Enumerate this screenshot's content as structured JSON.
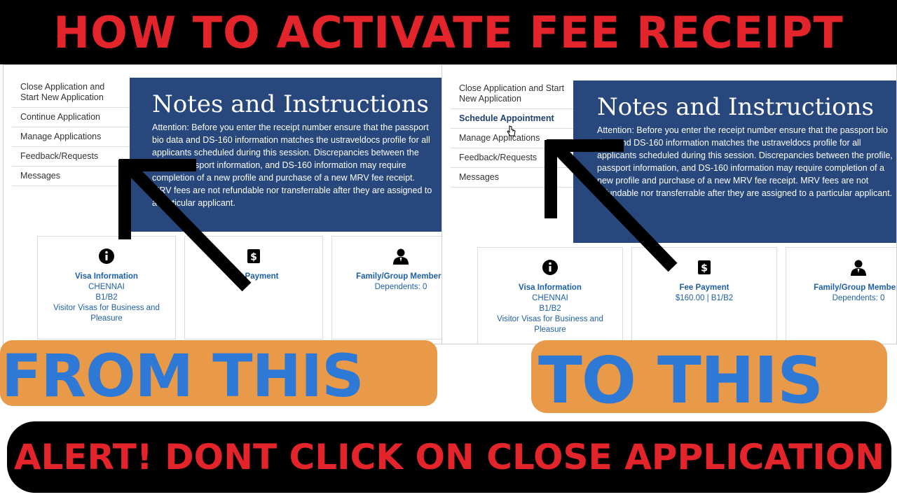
{
  "headline": "HOW TO ACTIVATE FEE RECEIPT",
  "before": {
    "menu": [
      "Close Application and Start New Application",
      "Continue Application",
      "Manage Applications",
      "Feedback/Requests",
      "Messages"
    ],
    "notes_title": "Notes and Instructions",
    "notes_text": "Attention: Before you enter the receipt number ensure that the passport bio data and DS-160 information matches the ustraveldocs profile for all applicants scheduled during this session. Discrepancies between the profile, passport information, and DS-160 information may require completion of a new profile and purchase of a new MRV fee receipt. MRV fees are not refundable nor transferrable after they are assigned to a particular applicant.",
    "cards": {
      "visa": {
        "title": "Visa Information",
        "line1": "CHENNAI",
        "line2": "B1/B2",
        "line3": "Visitor Visas for Business and Pleasure"
      },
      "fee": {
        "title": "Fee Payment"
      },
      "family": {
        "title": "Family/Group Members",
        "line1": "Dependents: 0"
      }
    }
  },
  "after": {
    "menu": [
      "Close Application and Start New Application",
      "Schedule Appointment",
      "Manage Applications",
      "Feedback/Requests",
      "Messages"
    ],
    "notes_title": "Notes and Instructions",
    "notes_text": "Attention: Before you enter the receipt number ensure that the passport bio data and DS-160 information matches the ustraveldocs profile for all applicants scheduled during this session. Discrepancies between the profile, passport information, and DS-160 information may require completion of a new profile and purchase of a new MRV fee receipt. MRV fees are not refundable nor transferrable after they are assigned to a particular applicant.",
    "cards": {
      "visa": {
        "title": "Visa Information",
        "line1": "CHENNAI",
        "line2": "B1/B2",
        "line3": "Visitor Visas for Business and Pleasure"
      },
      "fee": {
        "title": "Fee Payment",
        "line1": "$160.00 | B1/B2"
      },
      "family": {
        "title": "Family/Group Members",
        "line1": "Dependents: 0"
      }
    }
  },
  "label_from": "FROM THIS",
  "label_to": "TO THIS",
  "alert": "ALERT! DONT CLICK ON CLOSE APPLICATION",
  "colors": {
    "headline_text": "#e3242b",
    "notes_bg": "#28487d",
    "link_blue": "#1d5fa8",
    "label_blue": "#2e78d6",
    "label_orange": "#e89a48"
  },
  "icons": [
    "info-circle-icon",
    "dollar-icon",
    "person-icon",
    "mouse-pointer-icon",
    "arrow-icon"
  ]
}
